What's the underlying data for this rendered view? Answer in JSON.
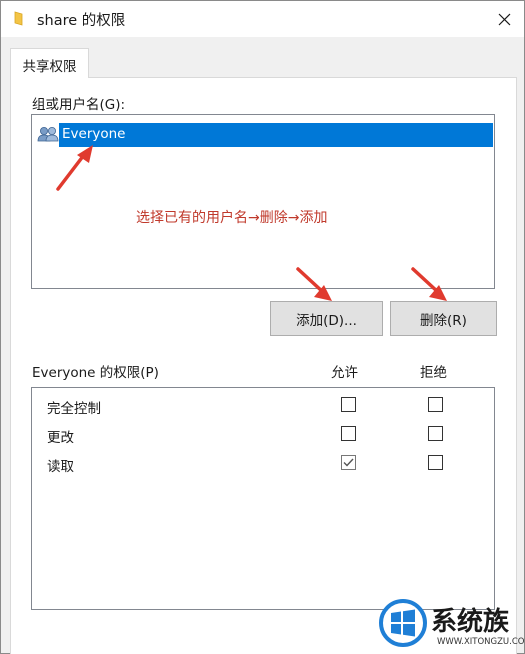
{
  "window": {
    "title": "share 的权限",
    "close_glyph": "✕"
  },
  "tabs": [
    {
      "label": "共享权限"
    }
  ],
  "users_group": {
    "label": "组或用户名(G):",
    "items": [
      {
        "name": "Everyone",
        "icon": "users-icon",
        "selected": true
      }
    ]
  },
  "annotation": {
    "text": "选择已有的用户名→删除→添加",
    "color": "#c0392b"
  },
  "buttons": {
    "add": "添加(D)...",
    "remove": "删除(R)"
  },
  "permissions": {
    "label": "Everyone 的权限(P)",
    "col_allow": "允许",
    "col_deny": "拒绝",
    "rows": [
      {
        "name": "完全控制",
        "allow": false,
        "deny": false
      },
      {
        "name": "更改",
        "allow": false,
        "deny": false
      },
      {
        "name": "读取",
        "allow": true,
        "deny": false
      }
    ]
  },
  "watermark": {
    "brand": "系统族",
    "url": "WWW.XITONGZU.COM"
  },
  "colors": {
    "selection": "#0078d7",
    "annotation_arrows": "#e03a2e"
  }
}
